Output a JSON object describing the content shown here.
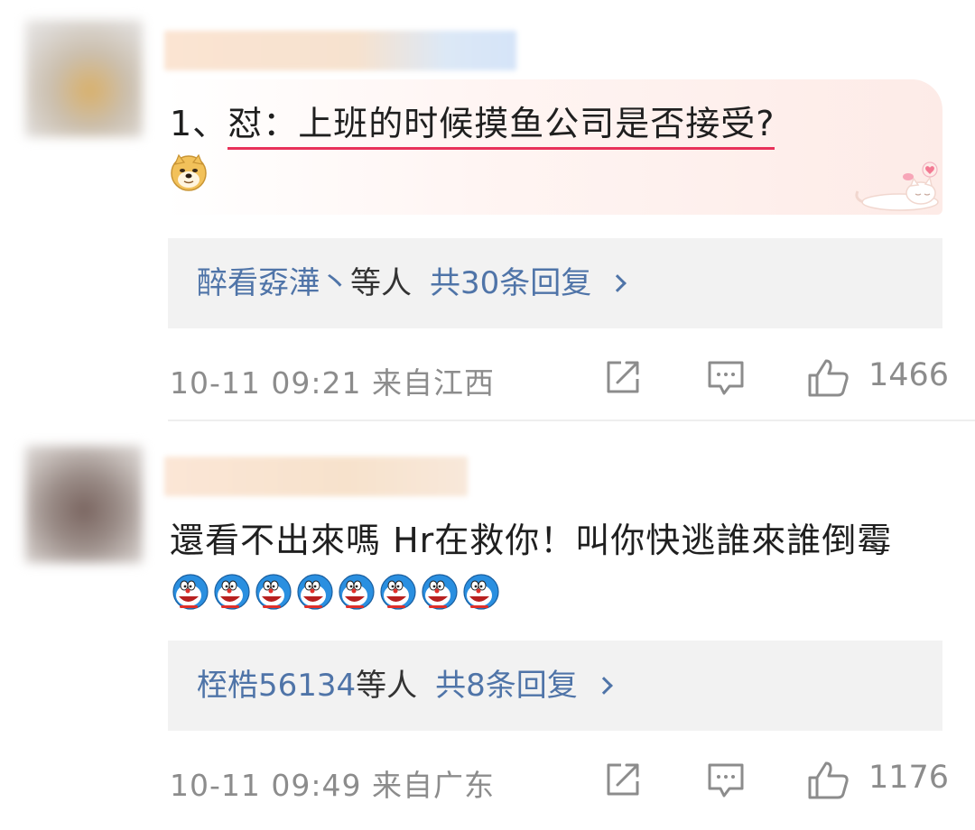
{
  "comments": [
    {
      "text_prefix": "1、",
      "text_emph": "怼：上班的时候摸鱼公司是否接受?",
      "emoji": "doge-icon",
      "replies": {
        "names": "醉看孬澕丶",
        "etc": "等人",
        "count_label": "共30条回复"
      },
      "timestamp": "10-11 09:21",
      "location": "来自江西",
      "likes": "1466"
    },
    {
      "text": "還看不出來嗎 Hr在救你！叫你快逃誰來誰倒霉",
      "emoji_count": 8,
      "emoji": "doraemon-icon",
      "replies": {
        "names": "桎梏56134",
        "etc": "等人",
        "count_label": "共8条回复"
      },
      "timestamp": "10-11 09:49",
      "location": "来自广东",
      "likes": "1176"
    }
  ],
  "colors": {
    "link": "#4f74a8",
    "meta": "#8c8c8c",
    "underline": "#e8315a",
    "reply_bg": "#f2f2f2"
  }
}
